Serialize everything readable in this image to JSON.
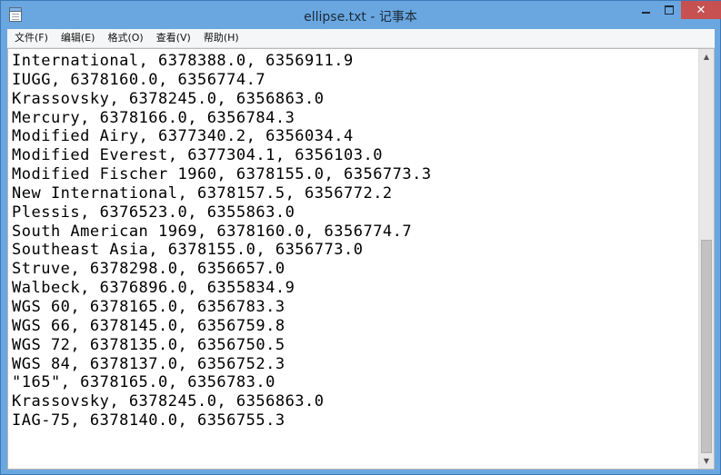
{
  "window": {
    "title": "ellipse.txt - 记事本",
    "minimize_icon": "minimize-icon",
    "maximize_icon": "maximize-icon",
    "close_glyph": "✕"
  },
  "menu": {
    "items": [
      {
        "label": "文件(F)"
      },
      {
        "label": "编辑(E)"
      },
      {
        "label": "格式(O)"
      },
      {
        "label": "查看(V)"
      },
      {
        "label": "帮助(H)"
      }
    ]
  },
  "editor": {
    "lines": [
      "International, 6378388.0, 6356911.9",
      "IUGG, 6378160.0, 6356774.7",
      "Krassovsky, 6378245.0, 6356863.0",
      "Mercury, 6378166.0, 6356784.3",
      "Modified Airy, 6377340.2, 6356034.4",
      "Modified Everest, 6377304.1, 6356103.0",
      "Modified Fischer 1960, 6378155.0, 6356773.3",
      "New International, 6378157.5, 6356772.2",
      "Plessis, 6376523.0, 6355863.0",
      "South American 1969, 6378160.0, 6356774.7",
      "Southeast Asia, 6378155.0, 6356773.0",
      "Struve, 6378298.0, 6356657.0",
      "Walbeck, 6376896.0, 6355834.9",
      "WGS 60, 6378165.0, 6356783.3",
      "WGS 66, 6378145.0, 6356759.8",
      "WGS 72, 6378135.0, 6356750.5",
      "WGS 84, 6378137.0, 6356752.3",
      "\"165\", 6378165.0, 6356783.0",
      "Krassovsky, 6378245.0, 6356863.0",
      "IAG-75, 6378140.0, 6356755.3"
    ]
  },
  "scrollbar": {
    "up_arrow": "▲",
    "down_arrow": "▼",
    "position_fraction": 1.0,
    "visible_fraction": 0.55
  },
  "colors": {
    "titlebar": "#6aa7e0",
    "close_button": "#c75050"
  }
}
